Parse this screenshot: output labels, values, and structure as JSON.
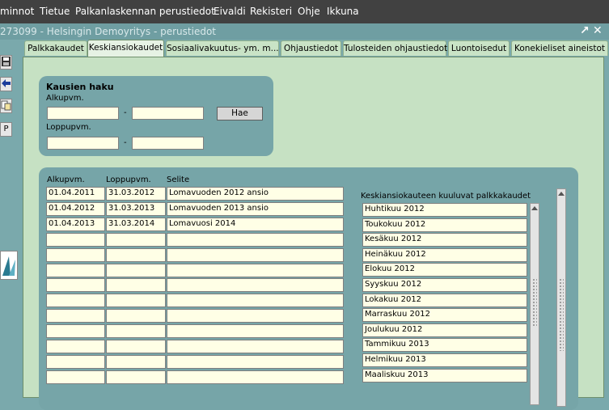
{
  "menu": [
    "minnot",
    "Tietue",
    "Palkanlaskennan perustiedot",
    "Eivaldi",
    "Rekisteri",
    "Ohje",
    "Ikkuna"
  ],
  "window": {
    "title": "273099 - Helsingin Demoyritys - perustiedot",
    "restore": "↗",
    "close": "✕"
  },
  "toolbar": {
    "p_label": "P"
  },
  "tabs": [
    "Palkkakaudet",
    "Keskiansiokaudet",
    "Sosiaalivakuutus- ym. m...",
    "Ohjaustiedot",
    "Tulosteiden ohjaustiedot",
    "Luontoisedut",
    "Konekieliset aineistot"
  ],
  "search": {
    "title": "Kausien haku",
    "start_label": "Alkupvm.",
    "end_label": "Loppupvm.",
    "dash": "-",
    "fetch_button": "Hae"
  },
  "table": {
    "headers": [
      "Alkupvm.",
      "Loppupvm.",
      "Selite"
    ],
    "rows": [
      [
        "01.04.2011",
        "31.03.2012",
        "Lomavuoden 2012 ansio"
      ],
      [
        "01.04.2012",
        "31.03.2013",
        "Lomavuoden 2013 ansio"
      ],
      [
        "01.04.2013",
        "31.03.2014",
        "Lomavuosi 2014"
      ],
      [
        "",
        "",
        ""
      ],
      [
        "",
        "",
        ""
      ],
      [
        "",
        "",
        ""
      ],
      [
        "",
        "",
        ""
      ],
      [
        "",
        "",
        ""
      ],
      [
        "",
        "",
        ""
      ],
      [
        "",
        "",
        ""
      ],
      [
        "",
        "",
        ""
      ],
      [
        "",
        "",
        ""
      ],
      [
        "",
        "",
        ""
      ]
    ]
  },
  "periods": {
    "header": "Keskiansiokauteen kuuluvat palkkakaudet",
    "items": [
      "Huhtikuu 2012",
      "Toukokuu 2012",
      "Kesäkuu 2012",
      "Heinäkuu 2012",
      "Elokuu 2012",
      "Syyskuu 2012",
      "Lokakuu 2012",
      "Marraskuu 2012",
      "Joulukuu 2012",
      "Tammikuu 2013",
      "Helmikuu 2013",
      "Maaliskuu 2013"
    ]
  }
}
